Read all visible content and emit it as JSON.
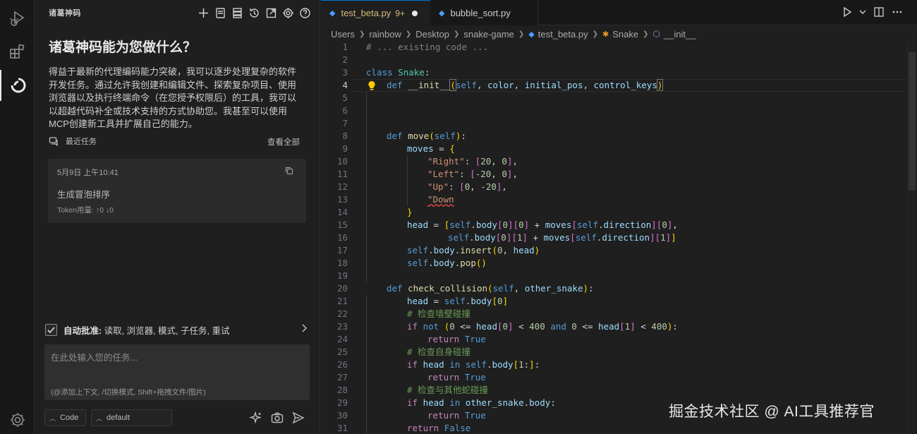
{
  "activity_bar": {
    "items": [
      {
        "name": "run-debug-icon"
      },
      {
        "name": "extensions-icon"
      },
      {
        "name": "ai-assistant-icon"
      }
    ],
    "settings_icon": "gear-icon"
  },
  "side_panel": {
    "title": "诸葛神码",
    "toolbar_icons": [
      "plus-icon",
      "history-file-icon",
      "list-icon",
      "history-icon",
      "open-external-icon",
      "gear-icon",
      "help-icon"
    ],
    "hero": "诸葛神码能为您做什么？",
    "description": "得益于最新的代理编码能力突破，我可以逐步处理复杂的软件开发任务。通过允许我创建和编辑文件、探索复杂项目、使用浏览器以及执行终端命令（在您授予权限后）的工具，我可以以超越代码补全或技术支持的方式协助您。我甚至可以使用MCP创建新工具并扩展自己的能力。",
    "recent_label": "最近任务",
    "view_all": "查看全部",
    "recent_task": {
      "date": "5月9日 上午10:41",
      "title": "生成冒泡排序",
      "tokens": "Token用量: ↑0 ↓0"
    },
    "auto_approve": {
      "label": "自动批准:",
      "items": "读取, 浏览器, 模式, 子任务, 重试",
      "checked": true
    },
    "task_input": {
      "placeholder": "在此处输入您的任务...",
      "hint": "(@添加上下文, /切换模式, Shift+拖拽文件/图片)"
    },
    "mode_select": "Code",
    "model_select": "default"
  },
  "editor": {
    "tabs": [
      {
        "label": "test_beta.py",
        "badge": "9+",
        "modified": true,
        "active": true
      },
      {
        "label": "bubble_sort.py",
        "active": false
      }
    ],
    "breadcrumb": [
      "Users",
      "rainbow",
      "Desktop",
      "snake-game",
      "test_beta.py",
      "Snake",
      "__init__"
    ],
    "current_line": 4,
    "line_numbers": [
      "1",
      "2",
      "3",
      "4",
      "5",
      "6",
      "7",
      "8",
      "9",
      "10",
      "11",
      "12",
      "13",
      "14",
      "15",
      "16",
      "17",
      "18",
      "19",
      "20",
      "21",
      "22",
      "23",
      "24",
      "25",
      "26",
      "27",
      "28",
      "29",
      "30",
      "31"
    ],
    "code": {
      "l1": "# ... existing code ...",
      "l3_kw": "class",
      "l3_name": "Snake",
      "l4_kw": "def",
      "l4_fn": "__init__",
      "l4_self": "self",
      "l4_params": ", color, initial_pos, control_keys",
      "l8_kw": "def",
      "l8_fn": "move",
      "l8_self": "self",
      "l9_var": "moves",
      "l10_key": "\"Right\"",
      "l10_a": "20",
      "l10_b": "0",
      "l11_key": "\"Left\"",
      "l11_a": "-20",
      "l11_b": "0",
      "l12_key": "\"Up\"",
      "l12_a": "0",
      "l12_b": "-20",
      "l13_key": "\"Down",
      "l15_var": "head",
      "l15_self": "self",
      "l15_body": "body",
      "l15_i0": "0",
      "l15_moves": "moves",
      "l15_dir": "direction",
      "l16_i1": "1",
      "l17_call": "insert",
      "l17_arg0": "0",
      "l17_arg1": "head",
      "l18_call": "pop",
      "l20_kw": "def",
      "l20_fn": "check_collision",
      "l20_self": "self",
      "l20_param": "other_snake",
      "l21_var": "head",
      "l22_comment": "# 检查墙壁碰撞",
      "l23_kw": "if",
      "l23_not": "not",
      "l23_and": "and",
      "l23_400": "400",
      "l24_ret": "return",
      "l24_val": "True",
      "l25_comment": "# 检查自身碰撞",
      "l26_kw": "if",
      "l26_in": "in",
      "l27_ret": "return",
      "l27_val": "True",
      "l28_comment": "# 检查与其他蛇碰撞",
      "l29_kw": "if",
      "l29_in": "in",
      "l29_var": "other_snake",
      "l30_ret": "return",
      "l30_val": "True",
      "l31_ret": "return",
      "l31_val": "False"
    }
  },
  "watermark": "掘金技术社区 @ AI工具推荐官",
  "colors": {
    "accent": "#0078d4",
    "background": "#1f1f1f",
    "keyword": "#569cd6",
    "function": "#dcdcaa",
    "string": "#ce9178",
    "comment": "#6a9955"
  }
}
